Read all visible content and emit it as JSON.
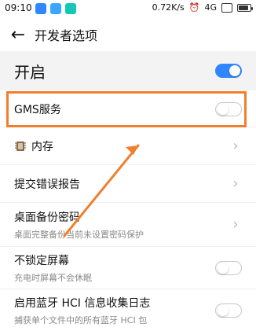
{
  "status_bar": {
    "time": "09:10",
    "network_speed": "0.72K/s",
    "network_type": "4G",
    "battery_level_percent": 80
  },
  "app_bar": {
    "title": "开发者选项"
  },
  "section": {
    "title": "开启",
    "enabled": true
  },
  "rows": [
    {
      "id": "gms",
      "title": "GMS服务",
      "subtitle": "",
      "control": "toggle",
      "toggle_on": false
    },
    {
      "id": "memory",
      "title": "内存",
      "subtitle": "",
      "control": "chevron",
      "icon": "chip-icon"
    },
    {
      "id": "bug_report",
      "title": "提交错误报告",
      "subtitle": "",
      "control": "chevron"
    },
    {
      "id": "desktop_backup_password",
      "title": "桌面备份密码",
      "subtitle": "桌面完整备份当前未设置密码保护",
      "control": "chevron"
    },
    {
      "id": "stay_awake",
      "title": "不锁定屏幕",
      "subtitle": "充电时屏幕不会休眠",
      "control": "toggle",
      "toggle_on": false
    },
    {
      "id": "bt_hci_log",
      "title": "启用蓝牙 HCI 信息收集日志",
      "subtitle": "捕获单个文件中的所有蓝牙 HCI 包",
      "control": "toggle",
      "toggle_on": false
    }
  ],
  "colors": {
    "accent": "#2f88ff",
    "highlight": "#f07f2e",
    "section_bg": "#f3f3f3",
    "chevron": "#b8b8b8"
  },
  "icons": {
    "back": "arrow-left-icon",
    "chevron": "chevron-right-icon",
    "memory": "chip-icon"
  }
}
